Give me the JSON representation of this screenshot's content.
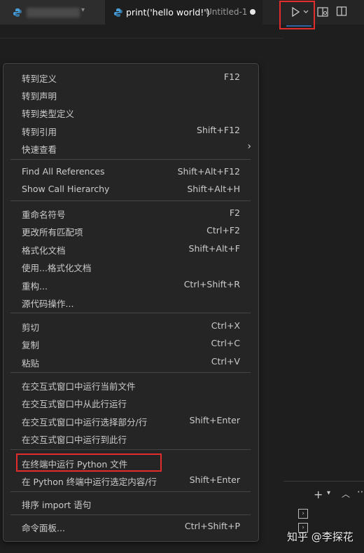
{
  "tabs": {
    "active": {
      "title": "print('hello world!')",
      "description": "Untitled-1"
    }
  },
  "context_menu": {
    "items": [
      {
        "label": "转到定义",
        "shortcut": "F12"
      },
      {
        "label": "转到声明",
        "shortcut": ""
      },
      {
        "label": "转到类型定义",
        "shortcut": ""
      },
      {
        "label": "转到引用",
        "shortcut": "Shift+F12"
      },
      {
        "label": "快速查看",
        "shortcut": "",
        "submenu": true
      },
      {
        "label": "Find All References",
        "shortcut": "Shift+Alt+F12"
      },
      {
        "label": "Show Call Hierarchy",
        "shortcut": "Shift+Alt+H"
      },
      {
        "label": "重命名符号",
        "shortcut": "F2"
      },
      {
        "label": "更改所有匹配项",
        "shortcut": "Ctrl+F2"
      },
      {
        "label": "格式化文档",
        "shortcut": "Shift+Alt+F"
      },
      {
        "label": "使用...格式化文档",
        "shortcut": ""
      },
      {
        "label": "重构...",
        "shortcut": "Ctrl+Shift+R"
      },
      {
        "label": "源代码操作...",
        "shortcut": ""
      },
      {
        "label": "剪切",
        "shortcut": "Ctrl+X"
      },
      {
        "label": "复制",
        "shortcut": "Ctrl+C"
      },
      {
        "label": "粘贴",
        "shortcut": "Ctrl+V"
      },
      {
        "label": "在交互式窗口中运行当前文件",
        "shortcut": ""
      },
      {
        "label": "在交互式窗口中从此行运行",
        "shortcut": ""
      },
      {
        "label": "在交互式窗口中运行选择部分/行",
        "shortcut": "Shift+Enter"
      },
      {
        "label": "在交互式窗口中运行到此行",
        "shortcut": ""
      },
      {
        "label": "在终端中运行 Python 文件",
        "shortcut": ""
      },
      {
        "label": "在 Python 终端中运行选定内容/行",
        "shortcut": "Shift+Enter"
      },
      {
        "label": "排序 import 语句",
        "shortcut": ""
      },
      {
        "label": "命令面板...",
        "shortcut": "Ctrl+Shift+P"
      }
    ]
  },
  "watermark": "知乎 @李探花",
  "colors": {
    "background": "#1e1e1e",
    "menu_background": "#252526",
    "highlight_box": "#e22d2d",
    "python_icon": "#4a9fd8"
  }
}
